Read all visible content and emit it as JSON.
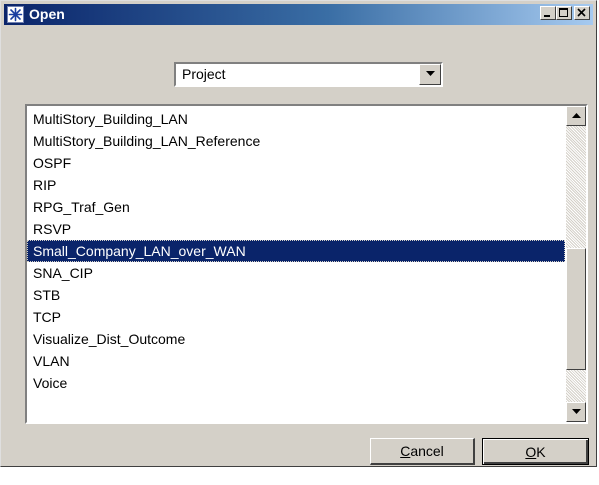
{
  "window": {
    "title": "Open"
  },
  "combo": {
    "value": "Project"
  },
  "list": {
    "items": [
      "MultiStory_Building_LAN",
      "MultiStory_Building_LAN_Reference",
      "OSPF",
      "RIP",
      "RPG_Traf_Gen",
      "RSVP",
      "Small_Company_LAN_over_WAN",
      "SNA_CIP",
      "STB",
      "TCP",
      "Visualize_Dist_Outcome",
      "VLAN",
      "Voice"
    ],
    "selected_index": 6
  },
  "buttons": {
    "cancel_mnemonic": "C",
    "cancel_rest": "ancel",
    "ok_mnemonic": "O",
    "ok_rest": "K"
  },
  "colors": {
    "title_active": "#0a246a",
    "selection": "#0a246a",
    "face": "#d4d0c8"
  },
  "icons": {
    "app": "star-icon",
    "minimize": "minimize-icon",
    "maximize": "maximize-icon",
    "close": "close-icon",
    "dropdown": "chevron-down-icon",
    "scroll_up": "scroll-up-icon",
    "scroll_down": "scroll-down-icon"
  }
}
